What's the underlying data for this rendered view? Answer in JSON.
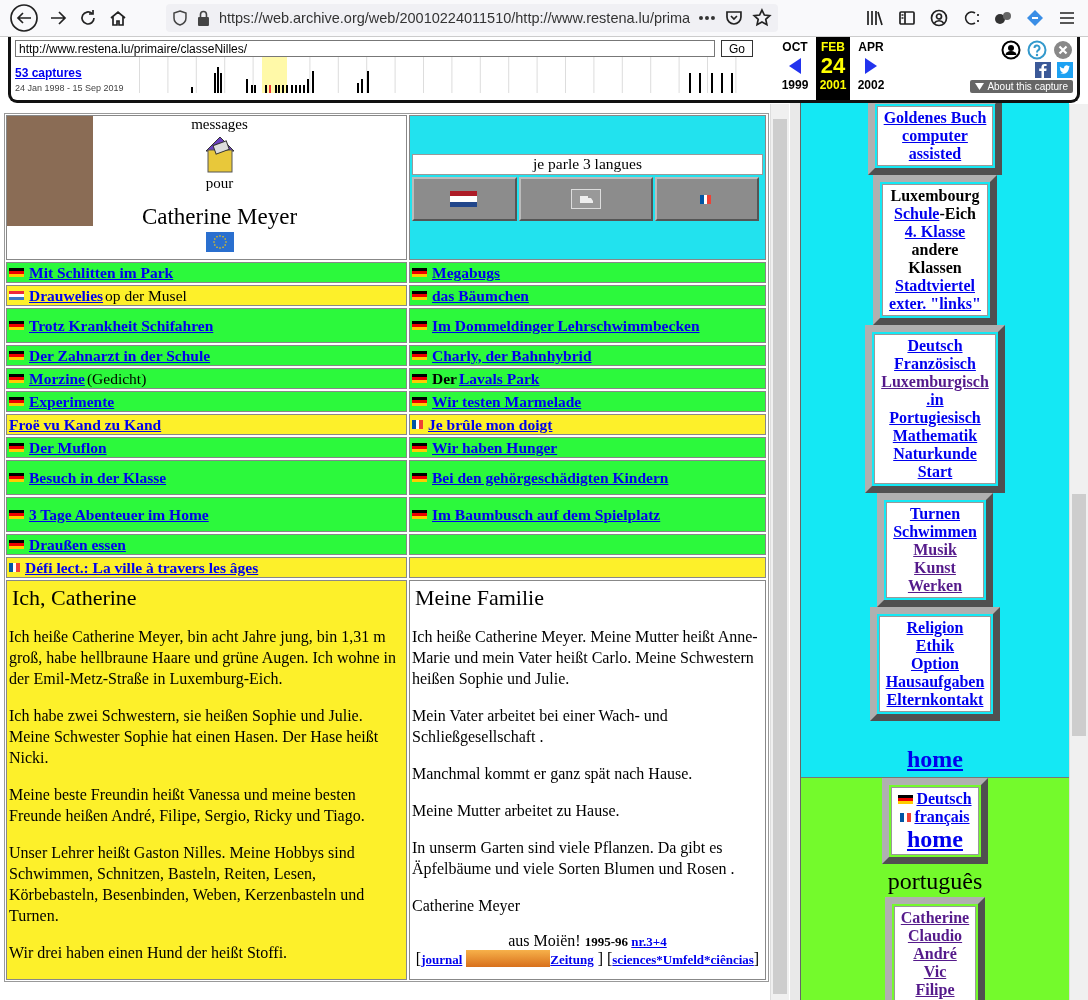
{
  "browser": {
    "url": "https://web.archive.org/web/20010224011510/http://www.restena.lu/prima"
  },
  "wayback": {
    "url": "http://www.restena.lu/primaire/classeNilles/",
    "go": "Go",
    "captures": "53 captures",
    "range": "24 Jan 1998 - 15 Sep 2019",
    "about": "About this capture",
    "months": [
      {
        "month": "OCT",
        "year": "1999",
        "selected": false
      },
      {
        "month": "FEB",
        "day": "24",
        "year": "2001",
        "selected": true
      },
      {
        "month": "APR",
        "year": "2002",
        "selected": false
      }
    ]
  },
  "header": {
    "messages": "messages",
    "pour": "pour",
    "name": "Catherine Meyer",
    "languages": "je parle 3 langues",
    "language_buttons": [
      {
        "kind": "nl"
      },
      {
        "kind": "broken"
      },
      {
        "kind": "fr"
      }
    ]
  },
  "rows": [
    {
      "tall": false,
      "cells": [
        {
          "color": "#2cf93c",
          "flag": {
            "kind": "de"
          },
          "parts": [
            {
              "kind": "link",
              "text": "Mit Schlitten im Park"
            }
          ]
        },
        {
          "color": "#2cf93c",
          "flag": {
            "kind": "de"
          },
          "parts": [
            {
              "kind": "link",
              "text": "Megabugs"
            }
          ]
        }
      ]
    },
    {
      "tall": false,
      "cells": [
        {
          "color": "#fdf02a",
          "flag": {
            "kind": "lu"
          },
          "parts": [
            {
              "kind": "link",
              "text": "Drauwelies"
            },
            {
              "kind": "text",
              "text": " op der Musel"
            }
          ]
        },
        {
          "color": "#2cf93c",
          "flag": {
            "kind": "de"
          },
          "parts": [
            {
              "kind": "link",
              "text": "das Bäumchen"
            }
          ]
        }
      ]
    },
    {
      "tall": true,
      "cells": [
        {
          "color": "#2cf93c",
          "flag": {
            "kind": "de"
          },
          "parts": [
            {
              "kind": "link",
              "text": "Trotz Krankheit Schifahren"
            }
          ]
        },
        {
          "color": "#2cf93c",
          "flag": {
            "kind": "de"
          },
          "parts": [
            {
              "kind": "link",
              "text": "Im Dommeldinger Lehrschwimmbecken"
            }
          ]
        }
      ]
    },
    {
      "tall": false,
      "cells": [
        {
          "color": "#2cf93c",
          "flag": {
            "kind": "de"
          },
          "parts": [
            {
              "kind": "link",
              "text": "Der Zahnarzt in der Schule"
            }
          ]
        },
        {
          "color": "#2cf93c",
          "flag": {
            "kind": "de"
          },
          "parts": [
            {
              "kind": "link",
              "text": "Charly, der Bahnhybrid"
            }
          ]
        }
      ]
    },
    {
      "tall": false,
      "cells": [
        {
          "color": "#2cf93c",
          "flag": {
            "kind": "de"
          },
          "parts": [
            {
              "kind": "link",
              "text": "Morzine "
            },
            {
              "kind": "text",
              "text": "(Gedicht)"
            }
          ]
        },
        {
          "color": "#2cf93c",
          "flag": {
            "kind": "de"
          },
          "parts": [
            {
              "kind": "bold",
              "text": "Der "
            },
            {
              "kind": "link",
              "text": "Lavals Park"
            }
          ]
        }
      ]
    },
    {
      "tall": false,
      "cells": [
        {
          "color": "#2cf93c",
          "flag": {
            "kind": "de"
          },
          "parts": [
            {
              "kind": "link",
              "text": "Experimente"
            }
          ]
        },
        {
          "color": "#2cf93c",
          "flag": {
            "kind": "de"
          },
          "parts": [
            {
              "kind": "link",
              "text": "Wir testen Marmelade"
            }
          ]
        }
      ]
    },
    {
      "tall": false,
      "cells": [
        {
          "color": "#fdf02a",
          "parts": [
            {
              "kind": "link",
              "text": "Froë vu Kand zu Kand"
            }
          ]
        },
        {
          "color": "#fdf02a",
          "flag": {
            "kind": "fr"
          },
          "parts": [
            {
              "kind": "link",
              "text": "Je brûle mon doigt"
            }
          ]
        }
      ]
    },
    {
      "tall": false,
      "cells": [
        {
          "color": "#2cf93c",
          "flag": {
            "kind": "de"
          },
          "parts": [
            {
              "kind": "link",
              "text": "Der Muflon"
            }
          ]
        },
        {
          "color": "#2cf93c",
          "flag": {
            "kind": "de"
          },
          "parts": [
            {
              "kind": "link",
              "text": "Wir haben Hunger"
            }
          ]
        }
      ]
    },
    {
      "tall": true,
      "cells": [
        {
          "color": "#2cf93c",
          "flag": {
            "kind": "de"
          },
          "parts": [
            {
              "kind": "link",
              "text": "Besuch in der Klasse"
            }
          ]
        },
        {
          "color": "#2cf93c",
          "flag": {
            "kind": "de"
          },
          "parts": [
            {
              "kind": "link",
              "text": "Bei den gehörgeschädigten Kindern"
            }
          ]
        }
      ]
    },
    {
      "tall": true,
      "cells": [
        {
          "color": "#2cf93c",
          "flag": {
            "kind": "de"
          },
          "parts": [
            {
              "kind": "link",
              "text": "3 Tage Abenteuer im Home"
            }
          ]
        },
        {
          "color": "#2cf93c",
          "flag": {
            "kind": "de"
          },
          "parts": [
            {
              "kind": "link",
              "text": "Im Baumbusch auf dem Spielplatz"
            }
          ]
        }
      ]
    },
    {
      "tall": false,
      "cells": [
        {
          "color": "#2cf93c",
          "flag": {
            "kind": "de"
          },
          "parts": [
            {
              "kind": "link",
              "text": "Draußen essen"
            }
          ]
        },
        {
          "color": "#2cf93c"
        }
      ]
    },
    {
      "tall": false,
      "cells": [
        {
          "color": "#fdf02a",
          "flag": {
            "kind": "fr"
          },
          "parts": [
            {
              "kind": "link",
              "text": "Défi lect.: La ville à travers les âges"
            }
          ]
        },
        {
          "color": "#fdf02a"
        }
      ]
    }
  ],
  "stories": [
    {
      "color": "#fdf02a",
      "title": "Ich, Catherine",
      "paragraphs": [
        "Ich heiße Catherine Meyer, bin acht Jahre jung, bin 1,31 m groß, habe hellbraune Haare und grüne Augen. Ich wohne in der Emil-Metz-Straße in Luxemburg-Eich.",
        "Ich habe zwei Schwestern, sie heißen Sophie und Julie. Meine Schwester Sophie hat einen Hasen. Der Hase heißt Nicki.",
        "Meine beste Freundin heißt Vanessa und meine besten Freunde heißen André, Filipe, Sergio, Ricky und Tiago.",
        "Unser Lehrer heißt Gaston Nilles. Meine Hobbys sind Schwimmen, Schnitzen, Basteln, Reiten, Lesen, Körbebasteln, Besenbinden, Weben, Kerzenbasteln und Turnen.",
        "Wir drei haben einen Hund der heißt Stoffi."
      ]
    },
    {
      "color": "#ffffff",
      "title": "Meine Familie",
      "paragraphs": [
        "Ich heiße Catherine Meyer. Meine Mutter heißt Anne- Marie und mein Vater heißt Carlo. Meine Schwestern heißen Sophie und Julie.",
        "Mein Vater arbeitet bei einer Wach- und Schließgesellschaft .",
        "Manchmal kommt er ganz spät nach Hause.",
        "Meine Mutter arbeitet zu Hause.",
        "In unserm Garten sind viele Pflanzen. Da gibt es Äpfelbäume und viele Sorten Blumen und Rosen .",
        "Catherine Meyer"
      ],
      "footer": [
        [
          {
            "kind": "text",
            "text": "aus Moiën! "
          },
          {
            "kind": "bold",
            "text": "1995-96 "
          },
          {
            "kind": "link",
            "text": "nr.3+4"
          }
        ],
        [
          {
            "kind": "text",
            "text": "["
          },
          {
            "kind": "link",
            "text": "journal"
          },
          {
            "kind": "image"
          },
          {
            "kind": "link",
            "text": "Zeitung"
          },
          {
            "kind": "text",
            "text": " ] ["
          },
          {
            "kind": "link",
            "text": "sciences*Umfeld*ciências"
          },
          {
            "kind": "text",
            "text": "]"
          }
        ]
      ]
    }
  ],
  "sidebar": {
    "sections": [
      {
        "color": "#14e8f4",
        "boxes": [
          {
            "lines": [
              [
                {
                  "kind": "link",
                  "text": "Goldenes Buch",
                  "visited": false
                }
              ],
              [
                {
                  "kind": "link",
                  "text": "computer",
                  "visited": false
                }
              ],
              [
                {
                  "kind": "link",
                  "text": "assisted",
                  "visited": false
                }
              ]
            ]
          },
          {
            "lines": [
              [
                {
                  "kind": "text",
                  "text": "Luxembourg"
                }
              ],
              [
                {
                  "kind": "link",
                  "text": "Schule",
                  "visited": false
                },
                {
                  "kind": "text",
                  "text": "-Eich"
                }
              ],
              [
                {
                  "kind": "link",
                  "text": "4. Klasse",
                  "visited": false
                }
              ],
              [
                {
                  "kind": "text",
                  "text": "andere"
                }
              ],
              [
                {
                  "kind": "text",
                  "text": "Klassen"
                }
              ],
              [
                {
                  "kind": "link",
                  "text": "Stadtviertel",
                  "visited": false
                }
              ],
              [
                {
                  "kind": "link",
                  "text": "exter. \"links\"",
                  "visited": false
                }
              ]
            ]
          },
          {
            "lines": [
              [
                {
                  "kind": "link",
                  "text": "Deutsch",
                  "visited": false
                }
              ],
              [
                {
                  "kind": "link",
                  "text": "Französisch",
                  "visited": false
                }
              ],
              [
                {
                  "kind": "link",
                  "text": "Luxemburgisch",
                  "visited": true
                }
              ],
              [
                {
                  "kind": "link",
                  "text": ".in",
                  "visited": false
                }
              ],
              [
                {
                  "kind": "link",
                  "text": "Portugiesisch",
                  "visited": false
                }
              ],
              [
                {
                  "kind": "link",
                  "text": "Mathematik",
                  "visited": false
                }
              ],
              [
                {
                  "kind": "link",
                  "text": "Naturkunde",
                  "visited": false
                }
              ],
              [
                {
                  "kind": "link",
                  "text": "Start",
                  "visited": false
                }
              ]
            ]
          },
          {
            "lines": [
              [
                {
                  "kind": "link",
                  "text": "Turnen",
                  "visited": false
                }
              ],
              [
                {
                  "kind": "link",
                  "text": "Schwimmen",
                  "visited": false
                }
              ],
              [
                {
                  "kind": "link",
                  "text": "Musik",
                  "visited": true
                }
              ],
              [
                {
                  "kind": "link",
                  "text": "Kunst",
                  "visited": true
                }
              ],
              [
                {
                  "kind": "link",
                  "text": "Werken",
                  "visited": true
                }
              ]
            ]
          },
          {
            "lines": [
              [
                {
                  "kind": "link",
                  "text": "Religion",
                  "visited": false
                }
              ],
              [
                {
                  "kind": "link",
                  "text": "Ethik",
                  "visited": false
                }
              ],
              [
                {
                  "kind": "link",
                  "text": "Option",
                  "visited": false
                }
              ],
              [
                {
                  "kind": "link",
                  "text": "Hausaufgaben",
                  "visited": false
                }
              ],
              [
                {
                  "kind": "link",
                  "text": "Elternkontakt",
                  "visited": false
                }
              ]
            ]
          }
        ],
        "home": "home"
      },
      {
        "color": "#74fa2c",
        "boxes": [
          {
            "lines": [
              [
                {
                  "kind": "de_flag"
                },
                {
                  "kind": "link",
                  "text": "Deutsch",
                  "visited": false
                }
              ],
              [
                {
                  "kind": "fr_flag"
                },
                {
                  "kind": "link",
                  "text": "français",
                  "visited": false
                }
              ],
              [
                {
                  "kind": "big",
                  "text": "home",
                  "visited": false
                }
              ]
            ]
          }
        ],
        "caption": "português",
        "boxes_after": [
          {
            "lines": [
              [
                {
                  "kind": "link",
                  "text": "Catherine",
                  "visited": true
                }
              ],
              [
                {
                  "kind": "link",
                  "text": "Claudio",
                  "visited": true
                }
              ],
              [
                {
                  "kind": "link",
                  "text": "André",
                  "visited": true
                }
              ],
              [
                {
                  "kind": "link",
                  "text": "Vic",
                  "visited": true
                }
              ],
              [
                {
                  "kind": "link",
                  "text": "Filipe",
                  "visited": true
                }
              ]
            ]
          }
        ]
      }
    ]
  }
}
